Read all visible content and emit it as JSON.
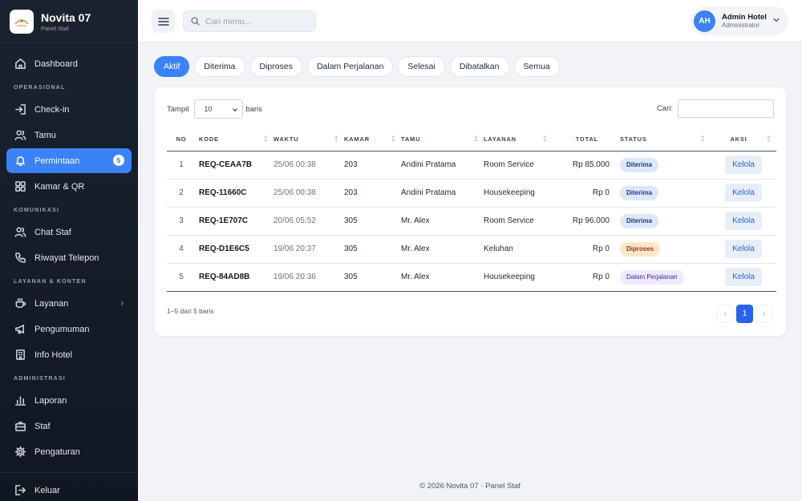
{
  "brand": {
    "name": "Novita 07",
    "subtitle": "Panel Staf"
  },
  "sidebar": {
    "dashboard": "Dashboard",
    "sections": {
      "operasional": "OPERASIONAL",
      "komunikasi": "KOMUNIKASI",
      "layanan_konten": "LAYANAN & KONTEN",
      "administrasi": "ADMINISTRASI"
    },
    "items": {
      "checkin": "Check-in",
      "tamu": "Tamu",
      "permintaan": "Permintaan",
      "permintaan_badge": "5",
      "kamar_qr": "Kamar & QR",
      "chat_staf": "Chat Staf",
      "riwayat_telepon": "Riwayat Telepon",
      "layanan": "Layanan",
      "pengumuman": "Pengumuman",
      "info_hotel": "Info Hotel",
      "laporan": "Laporan",
      "staf": "Staf",
      "pengaturan": "Pengaturan",
      "keluar": "Keluar"
    }
  },
  "header": {
    "search_placeholder": "Cari menu...",
    "user_initials": "AH",
    "user_name": "Admin Hotel",
    "user_role": "Administrator"
  },
  "tabs": [
    "Aktif",
    "Diterima",
    "Diproses",
    "Dalam Perjalanan",
    "Selesai",
    "Dibatalkan",
    "Semua"
  ],
  "active_tab": "Aktif",
  "table": {
    "length_label_before": "Tampil",
    "length_value": "10",
    "length_label_after": "baris",
    "search_label": "Cari:",
    "columns": {
      "no": "NO",
      "kode": "KODE",
      "waktu": "WAKTU",
      "kamar": "KAMAR",
      "tamu": "TAMU",
      "layanan": "LAYANAN",
      "total": "TOTAL",
      "status": "STATUS",
      "aksi": "AKSI"
    },
    "rows": [
      {
        "no": "1",
        "kode": "REQ-CEAA7B",
        "waktu": "25/06 00:38",
        "kamar": "203",
        "tamu": "Andini Pratama",
        "layanan": "Room Service",
        "total": "Rp 85.000",
        "status": "Diterima",
        "aksi": "Kelola"
      },
      {
        "no": "2",
        "kode": "REQ-11660C",
        "waktu": "25/06 00:38",
        "kamar": "203",
        "tamu": "Andini Pratama",
        "layanan": "Housekeeping",
        "total": "Rp 0",
        "status": "Diterima",
        "aksi": "Kelola"
      },
      {
        "no": "3",
        "kode": "REQ-1E707C",
        "waktu": "20/06 05:52",
        "kamar": "305",
        "tamu": "Mr. Alex",
        "layanan": "Room Service",
        "total": "Rp 96.000",
        "status": "Diterima",
        "aksi": "Kelola"
      },
      {
        "no": "4",
        "kode": "REQ-D1E6C5",
        "waktu": "19/06 20:37",
        "kamar": "305",
        "tamu": "Mr. Alex",
        "layanan": "Keluhan",
        "total": "Rp 0",
        "status": "Diproses",
        "aksi": "Kelola"
      },
      {
        "no": "5",
        "kode": "REQ-84AD8B",
        "waktu": "19/06 20:36",
        "kamar": "305",
        "tamu": "Mr. Alex",
        "layanan": "Housekeeping",
        "total": "Rp 0",
        "status": "Dalam Perjalanan",
        "aksi": "Kelola"
      }
    ],
    "info": "1–5 dari 5 baris",
    "pagination": {
      "prev": "‹",
      "current": "1",
      "next": "›"
    }
  },
  "footer": "© 2026 Novita 07 · Panel Staf",
  "colors": {
    "accent": "#3b82f6",
    "sidebar_bg": "#1b2230",
    "badge_diterima": "#dbe7fb",
    "badge_diproses": "#fde7c8",
    "badge_perjalanan": "#ede9fe"
  }
}
